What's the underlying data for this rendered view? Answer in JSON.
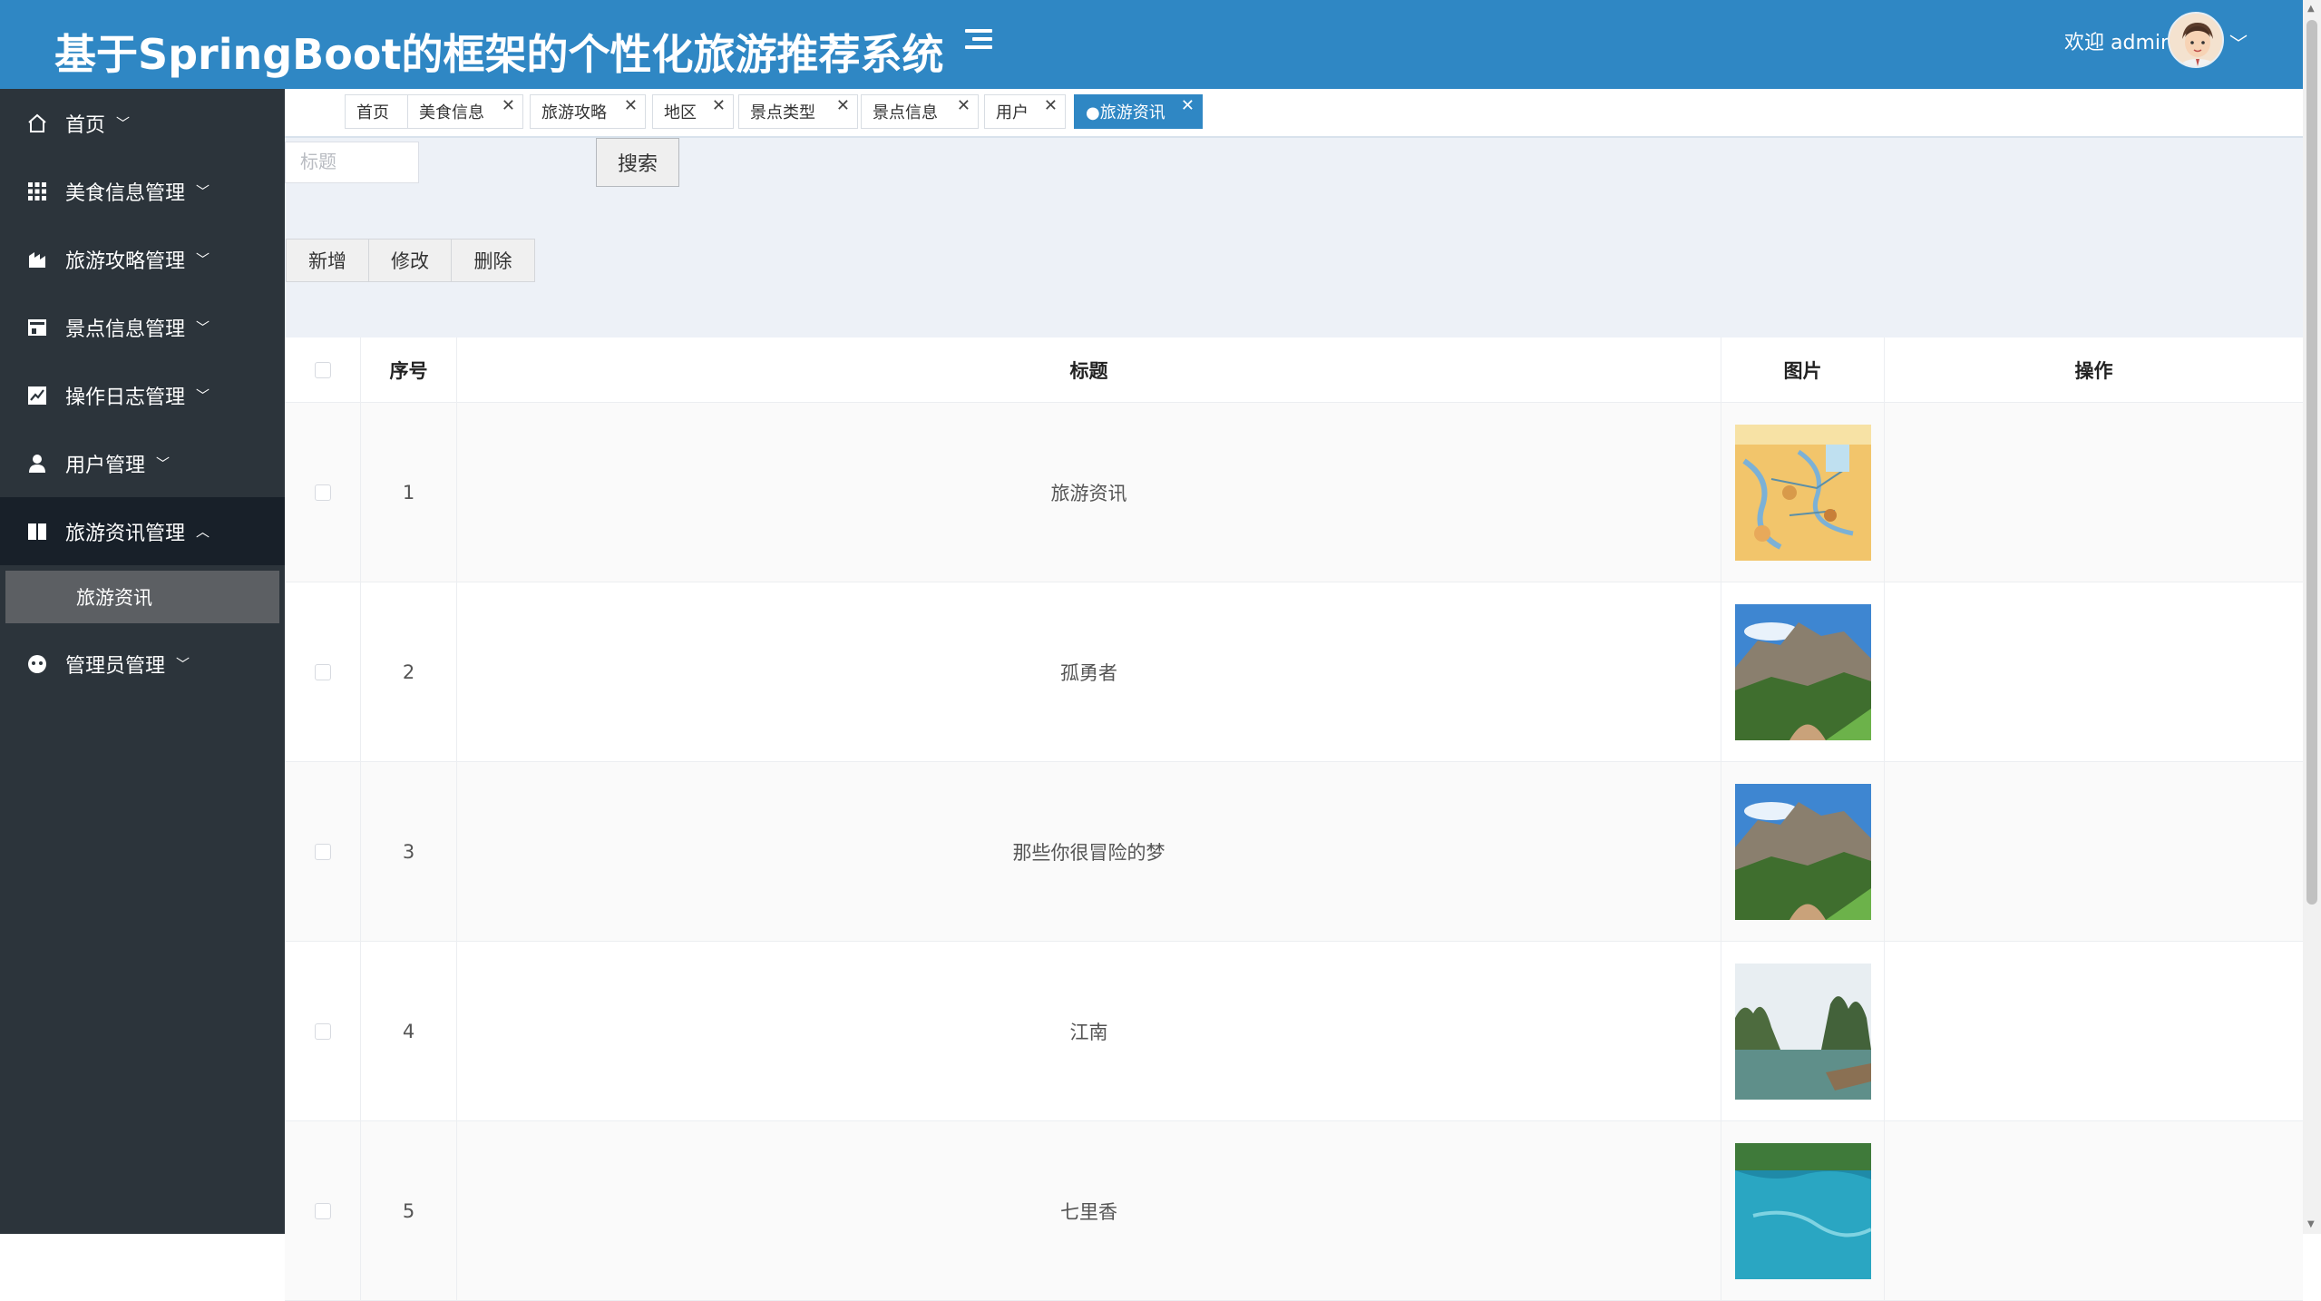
{
  "header": {
    "title": "基于SpringBoot的框架的个性化旅游推荐系统",
    "welcome": "欢迎 admin"
  },
  "sidebar": {
    "items": [
      {
        "label": "首页",
        "icon": "home-icon"
      },
      {
        "label": "美食信息管理",
        "icon": "grid-icon"
      },
      {
        "label": "旅游攻略管理",
        "icon": "chart-icon"
      },
      {
        "label": "景点信息管理",
        "icon": "store-icon"
      },
      {
        "label": "操作日志管理",
        "icon": "log-icon"
      },
      {
        "label": "用户管理",
        "icon": "user-icon"
      },
      {
        "label": "旅游资讯管理",
        "icon": "book-icon"
      },
      {
        "label": "管理员管理",
        "icon": "admin-icon"
      }
    ],
    "sub_item": "旅游资讯"
  },
  "tabs": [
    {
      "label": "首页"
    },
    {
      "label": "美食信息"
    },
    {
      "label": "旅游攻略"
    },
    {
      "label": "地区"
    },
    {
      "label": "景点类型"
    },
    {
      "label": "景点信息"
    },
    {
      "label": "用户"
    },
    {
      "label": "●旅游资讯"
    }
  ],
  "search": {
    "placeholder": "标题",
    "button": "搜索"
  },
  "actions": {
    "add": "新增",
    "edit": "修改",
    "delete": "删除"
  },
  "table": {
    "headers": {
      "no": "序号",
      "title": "标题",
      "image": "图片",
      "op": "操作"
    },
    "rows": [
      {
        "no": "1",
        "title": "旅游资讯",
        "image": "map-thumbnail"
      },
      {
        "no": "2",
        "title": "孤勇者",
        "image": "mountain-thumbnail"
      },
      {
        "no": "3",
        "title": "那些你很冒险的梦",
        "image": "mountain-thumbnail"
      },
      {
        "no": "4",
        "title": "江南",
        "image": "lake-thumbnail"
      },
      {
        "no": "5",
        "title": "七里香",
        "image": "water-thumbnail"
      }
    ]
  },
  "colors": {
    "header": "#2f87c4",
    "sidebar": "#2c343b",
    "active_tab": "#2f87c4"
  }
}
